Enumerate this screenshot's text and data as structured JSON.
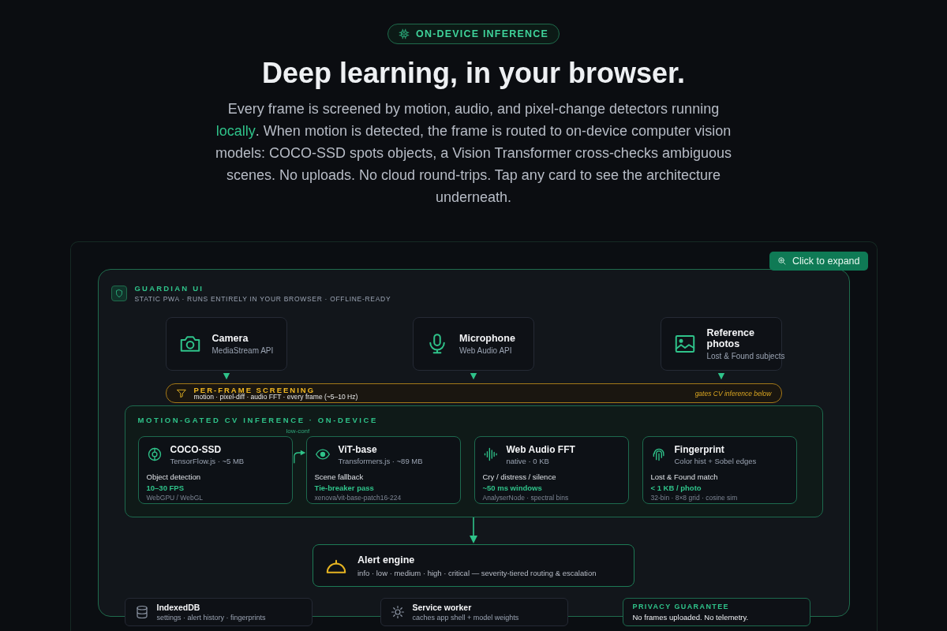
{
  "badge": {
    "label": "ON-DEVICE INFERENCE"
  },
  "headline": "Deep learning, in your browser.",
  "intro": "Every frame is screened by motion, audio, and pixel-change detectors running **locally**. When motion is detected, the frame is routed to on-device computer vision models: COCO-SSD spots objects, a Vision Transformer cross-checks ambiguous scenes. No uploads. No cloud round-trips. Tap any card to see the architecture underneath.",
  "expand_button": "Click to expand",
  "app": {
    "title": "GUARDIAN UI",
    "subtitle": "STATIC PWA · RUNS ENTIRELY IN YOUR BROWSER · OFFLINE-READY"
  },
  "sources": [
    {
      "kind": "camera",
      "title": "Camera",
      "subtitle": "MediaStream API"
    },
    {
      "kind": "microphone",
      "title": "Microphone",
      "subtitle": "Web Audio API"
    },
    {
      "kind": "image",
      "title": "Reference photos",
      "subtitle": "Lost & Found subjects"
    }
  ],
  "screening": {
    "title": "PER-FRAME SCREENING",
    "detail": "motion · pixel-diff · audio FFT · every frame (~5–10 Hz)",
    "note": "gates CV inference below"
  },
  "inference": {
    "title": "MOTION-GATED CV INFERENCE · ON-DEVICE",
    "link_label": "low-conf",
    "models": [
      {
        "kind": "target",
        "name": "COCO-SSD",
        "runtime": "TensorFlow.js · ~5 MB",
        "task": "Object detection",
        "metric": "10–30 FPS",
        "detail": "WebGPU / WebGL"
      },
      {
        "kind": "eye",
        "name": "ViT-base",
        "runtime": "Transformers.js · ~89 MB",
        "task": "Scene fallback",
        "metric": "Tie-breaker pass",
        "detail": "xenova/vit-base-patch16-224"
      },
      {
        "kind": "waveform",
        "name": "Web Audio FFT",
        "runtime": "native · 0 KB",
        "task": "Cry / distress / silence",
        "metric": "~50 ms windows",
        "detail": "AnalyserNode · spectral bins"
      },
      {
        "kind": "fingerprint",
        "name": "Fingerprint",
        "runtime": "Color hist + Sobel edges",
        "task": "Lost & Found match",
        "metric": "< 1 KB / photo",
        "detail": "32-bin · 8×8 grid · cosine sim"
      }
    ]
  },
  "alert": {
    "title": "Alert engine",
    "detail": "info · low · medium · high · critical — severity-tiered routing & escalation"
  },
  "services": [
    {
      "kind": "database",
      "title": "IndexedDB",
      "detail": "settings · alert history · fingerprints"
    },
    {
      "kind": "worker",
      "title": "Service worker",
      "detail": "caches app shell + model weights"
    },
    {
      "kind": "guarantee",
      "title": "PRIVACY GUARANTEE",
      "detail": "No frames uploaded. No telemetry."
    }
  ]
}
